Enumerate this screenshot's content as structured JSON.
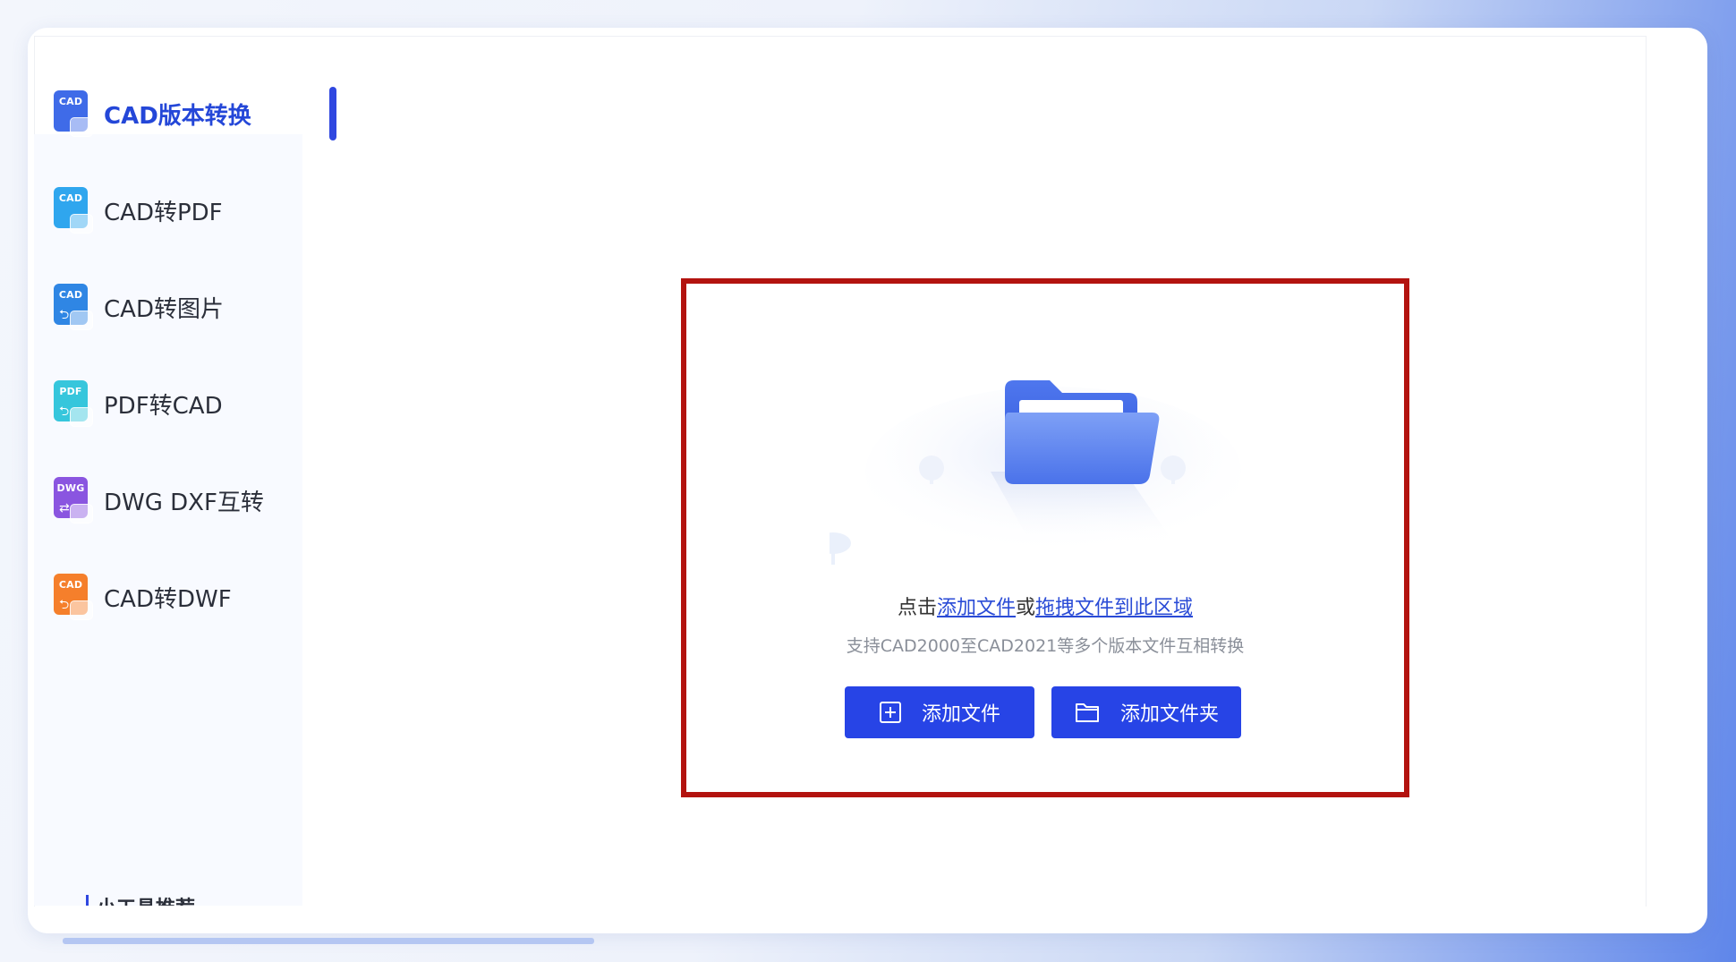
{
  "sidebar": {
    "items": [
      {
        "label": "CAD版本转换",
        "icon": "cad-version-icon",
        "badge": "CAD",
        "color": "#3f6be8",
        "active": true
      },
      {
        "label": "CAD转PDF",
        "icon": "cad-to-pdf-icon",
        "badge": "CAD",
        "color": "#2fa6ee",
        "active": false
      },
      {
        "label": "CAD转图片",
        "icon": "cad-to-image-icon",
        "badge": "CAD",
        "color": "#2f86e4",
        "active": false
      },
      {
        "label": "PDF转CAD",
        "icon": "pdf-to-cad-icon",
        "badge": "PDF",
        "color": "#36c6dc",
        "active": false
      },
      {
        "label": "DWG DXF互转",
        "icon": "dwg-dxf-icon",
        "badge": "DWG",
        "color": "#8a55e0",
        "active": false
      },
      {
        "label": "CAD转DWF",
        "icon": "cad-to-dwf-icon",
        "badge": "CAD",
        "color": "#f57f2b",
        "active": false
      }
    ],
    "bottom_label": "小工具推荐"
  },
  "drop_zone": {
    "hint_prefix": "点击",
    "add_file_link": "添加文件",
    "hint_or": "或",
    "drag_link": "拖拽文件到此区域",
    "subhint": "支持CAD2000至CAD2021等多个版本文件互相转换",
    "add_file_button": "添加文件",
    "add_folder_button": "添加文件夹"
  },
  "colors": {
    "accent": "#2744e6",
    "highlight_border": "#b3130f",
    "active_text": "#2447d8"
  }
}
